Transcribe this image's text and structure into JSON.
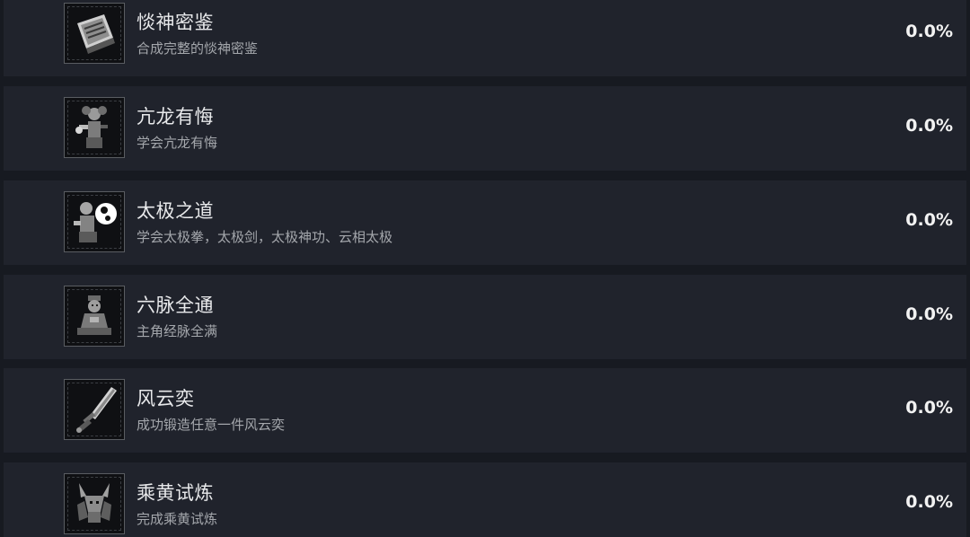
{
  "achievements": [
    {
      "title": "惔神密鉴",
      "description": "合成完整的惔神密鉴",
      "percent": "0.0%",
      "icon": "scroll-book-icon"
    },
    {
      "title": "亢龙有悔",
      "description": "学会亢龙有悔",
      "percent": "0.0%",
      "icon": "martial-artist-icon"
    },
    {
      "title": "太极之道",
      "description": "学会太极拳，太极剑，太极神功、云相太极",
      "percent": "0.0%",
      "icon": "taiji-master-icon"
    },
    {
      "title": "六脉全通",
      "description": "主角经脉全满",
      "percent": "0.0%",
      "icon": "meditating-figure-icon"
    },
    {
      "title": "风云奕",
      "description": "成功锻造任意一件风云奕",
      "percent": "0.0%",
      "icon": "blade-weapon-icon"
    },
    {
      "title": "乘黄试炼",
      "description": "完成乘黄试炼",
      "percent": "0.0%",
      "icon": "horned-beast-icon"
    }
  ]
}
